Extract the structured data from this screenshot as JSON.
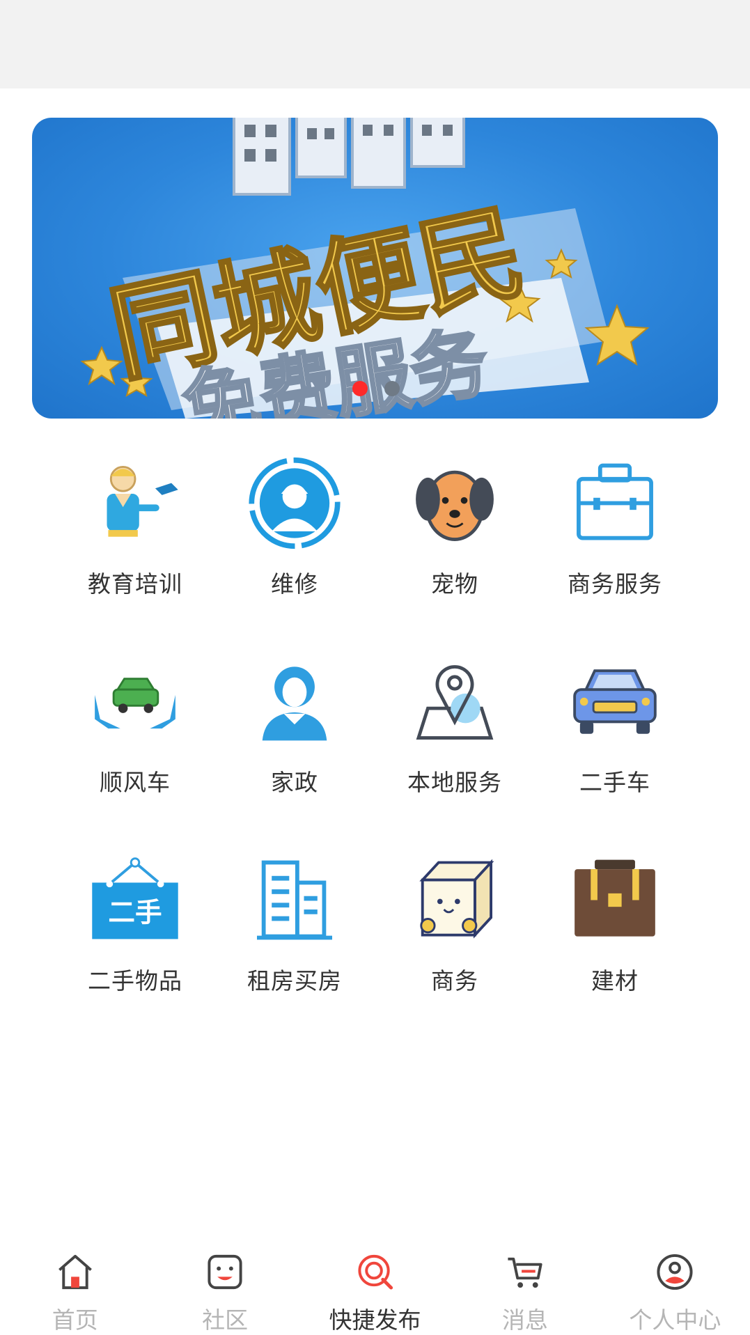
{
  "banner": {
    "line1": "同城便民",
    "line2": "免费服务",
    "active_slide": 1,
    "slide_count": 2
  },
  "categories": [
    {
      "label": "教育培训",
      "icon": "teacher-icon"
    },
    {
      "label": "维修",
      "icon": "repair-worker-icon"
    },
    {
      "label": "宠物",
      "icon": "dog-icon"
    },
    {
      "label": "商务服务",
      "icon": "briefcase-icon"
    },
    {
      "label": "顺风车",
      "icon": "carpool-hands-car-icon"
    },
    {
      "label": "家政",
      "icon": "housekeeper-icon"
    },
    {
      "label": "本地服务",
      "icon": "location-map-icon"
    },
    {
      "label": "二手车",
      "icon": "used-car-icon"
    },
    {
      "label": "二手物品",
      "icon": "secondhand-sign-icon"
    },
    {
      "label": "租房买房",
      "icon": "building-icon"
    },
    {
      "label": "商务",
      "icon": "tofu-box-icon"
    },
    {
      "label": "建材",
      "icon": "toolbox-icon"
    }
  ],
  "tabbar": {
    "items": [
      {
        "label": "首页",
        "icon": "home-icon",
        "active": false
      },
      {
        "label": "社区",
        "icon": "community-icon",
        "active": false
      },
      {
        "label": "快捷发布",
        "icon": "quick-publish-icon",
        "active": true
      },
      {
        "label": "消息",
        "icon": "cart-icon",
        "active": false
      },
      {
        "label": "个人中心",
        "icon": "user-icon",
        "active": false
      }
    ]
  },
  "colors": {
    "accent": "#f0463c",
    "tab_inactive": "#b5b5b5",
    "tab_active": "#333333",
    "banner_blue": "#2d86db",
    "banner_gold": "#f2c94c"
  }
}
